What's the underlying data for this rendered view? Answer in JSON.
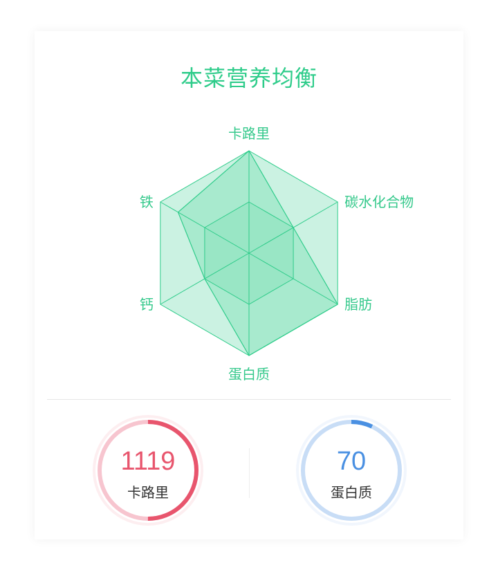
{
  "colors": {
    "accent": "#2ecc8a",
    "calorie": "#e8556d",
    "calorie_track": "#f7c5cf",
    "protein": "#4a90e2",
    "protein_track": "#c8ddf6"
  },
  "title": "本菜营养均衡",
  "chart_data": {
    "type": "radar",
    "axes": [
      "卡路里",
      "碳水化合物",
      "脂肪",
      "蛋白质",
      "钙",
      "铁"
    ],
    "max": 100,
    "levels": 2,
    "values": [
      100,
      50,
      100,
      100,
      50,
      80
    ]
  },
  "stats": [
    {
      "value": "1119",
      "label": "卡路里",
      "progress": 0.5,
      "icon": "calorie-ring"
    },
    {
      "value": "70",
      "label": "蛋白质",
      "progress": 0.07,
      "icon": "protein-ring"
    }
  ]
}
